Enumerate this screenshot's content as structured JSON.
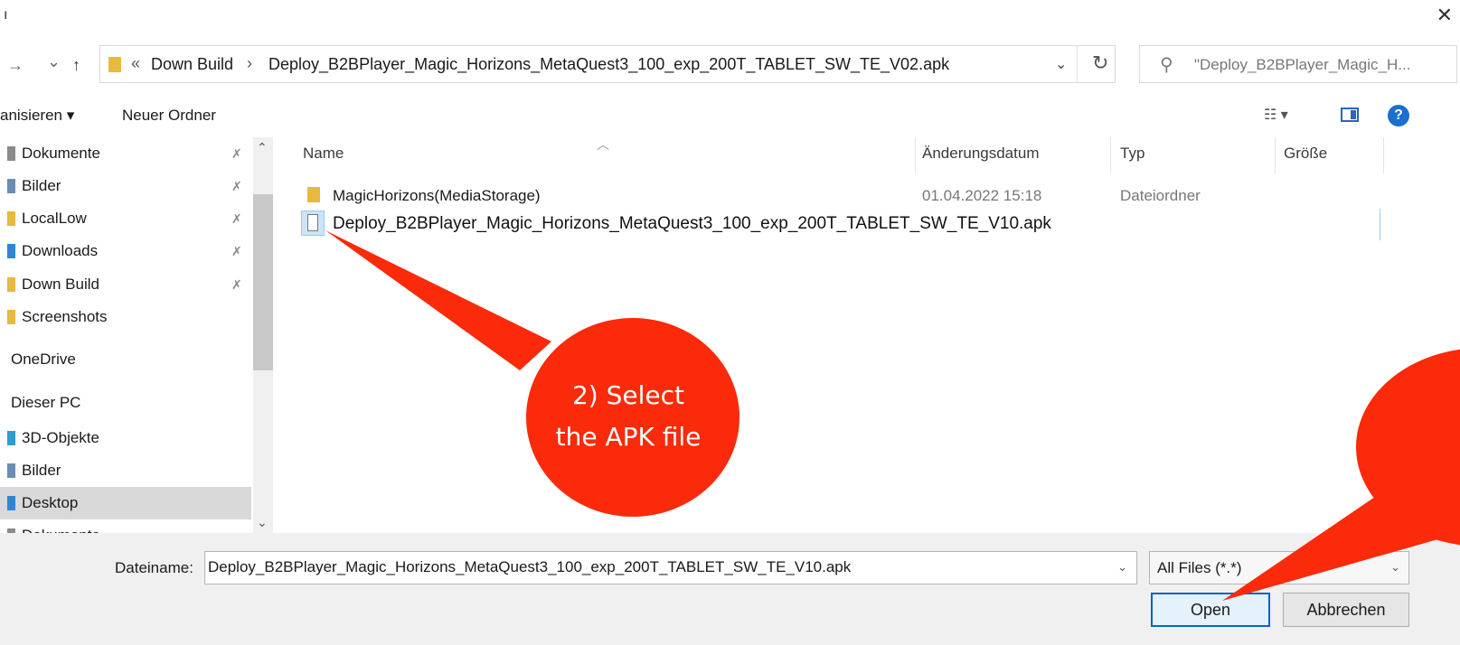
{
  "window": {
    "title_fragment": "ı",
    "close_glyph": "✕"
  },
  "nav": {
    "forward_glyph": "→",
    "history_glyph": "⌄",
    "up_glyph": "↑"
  },
  "address": {
    "overflow_glyph": "«",
    "segment_parent": "Down Build",
    "separator": "›",
    "segment_current": "Deploy_B2BPlayer_Magic_Horizons_MetaQuest3_100_exp_200T_TABLET_SW_TE_V02.apk",
    "dropdown_glyph": "⌄",
    "refresh_glyph": "↻"
  },
  "search": {
    "icon_glyph": "⚲",
    "text": "\"Deploy_B2BPlayer_Magic_H..."
  },
  "toolbar": {
    "organize_label": "anisieren ▾",
    "new_folder_label": "Neuer Ordner",
    "view_glyph": "☷ ▾",
    "help_glyph": "?"
  },
  "sidebar": {
    "items": [
      {
        "label": "Dokumente",
        "pinned": true,
        "icon_color": "#8a8a8a"
      },
      {
        "label": "Bilder",
        "pinned": true,
        "icon_color": "#6b8db5"
      },
      {
        "label": "LocalLow",
        "pinned": true,
        "icon_color": "#e8b93e"
      },
      {
        "label": "Downloads",
        "pinned": true,
        "icon_color": "#2f86d6"
      },
      {
        "label": "Down Build",
        "pinned": true,
        "icon_color": "#e8b93e"
      },
      {
        "label": "Screenshots",
        "pinned": false,
        "icon_color": "#e8b93e"
      },
      {
        "label": "OneDrive",
        "pinned": false,
        "icon_color": ""
      },
      {
        "label": "Dieser PC",
        "pinned": false,
        "icon_color": ""
      },
      {
        "label": "3D-Objekte",
        "pinned": false,
        "icon_color": "#2f9bd6"
      },
      {
        "label": "Bilder",
        "pinned": false,
        "icon_color": "#6b8db5"
      },
      {
        "label": "Desktop",
        "pinned": false,
        "icon_color": "#2f86d6"
      },
      {
        "label": "Dokumente",
        "pinned": false,
        "icon_color": "#8a8a8a"
      }
    ],
    "pin_glyph": "✗",
    "scroll_up_glyph": "⌃",
    "scroll_down_glyph": "⌄"
  },
  "columns": {
    "name": "Name",
    "date": "Änderungsdatum",
    "type": "Typ",
    "size": "Größe",
    "sort_glyph": "︿"
  },
  "files": [
    {
      "name": "MagicHorizons(MediaStorage)",
      "date": "01.04.2022 15:18",
      "type": "Dateiordner"
    },
    {
      "name": "Deploy_B2BPlayer_Magic_Horizons_MetaQuest3_100_exp_200T_TABLET_SW_TE_V10.apk",
      "date": "",
      "type": ""
    }
  ],
  "bottom": {
    "filename_label": "Dateiname:",
    "filename_value": "Deploy_B2BPlayer_Magic_Horizons_MetaQuest3_100_exp_200T_TABLET_SW_TE_V10.apk",
    "filename_drop_glyph": "⌄",
    "filetype_value": "All Files (*.*)",
    "filetype_drop_glyph": "⌄",
    "open_label": "Open",
    "cancel_label": "Abbrechen"
  },
  "annotation": {
    "line1": "2) Select",
    "line2": "the APK file",
    "color": "#fa2a0a"
  }
}
